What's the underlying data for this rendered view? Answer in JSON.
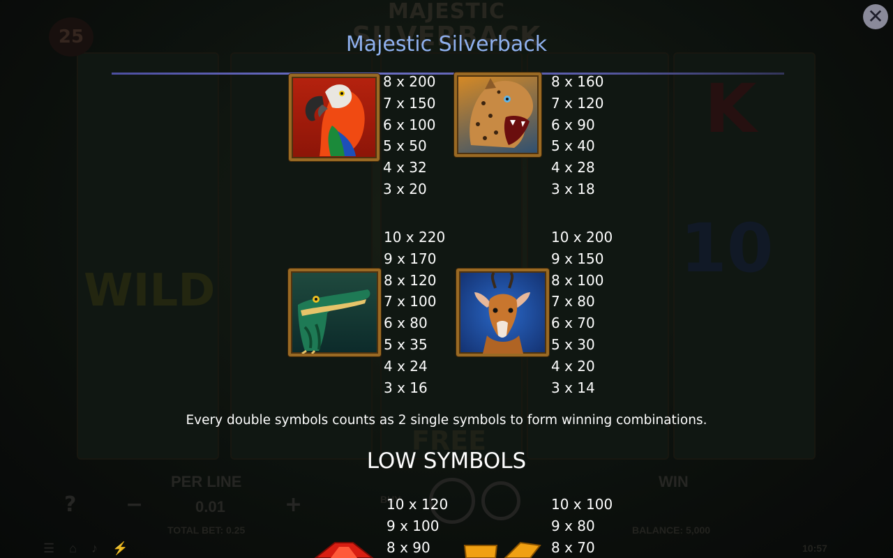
{
  "background": {
    "logo_line1": "MAJESTIC",
    "logo_line2": "SILVERBACK",
    "lines_count": "25",
    "wild_text": "WILD",
    "per_line_label": "PER LINE",
    "per_line_value": "0.01",
    "total_bet": "TOTAL BET: 0.25",
    "win_label": "WIN",
    "balance": "BALANCE: 5,000",
    "buy_label": "BUY",
    "free_text": "FREE",
    "minus": "−",
    "plus": "+",
    "help": "?",
    "clock": "10:57"
  },
  "paytable": {
    "title": "Majestic Silverback",
    "close_icon": "✕",
    "symbols": [
      {
        "name": "parrot",
        "payouts": [
          "8 x 200",
          "7 x 150",
          "6 x 100",
          "5 x 50",
          "4 x 32",
          "3 x 20"
        ]
      },
      {
        "name": "leopard",
        "payouts": [
          "8 x 160",
          "7 x 120",
          "6 x 90",
          "5 x 40",
          "4 x 28",
          "3 x 18"
        ]
      },
      {
        "name": "crocodile",
        "payouts": [
          "10 x 220",
          "9 x 170",
          "8 x 120",
          "7 x 100",
          "6 x 80",
          "5 x 35",
          "4 x 24",
          "3 x 16"
        ]
      },
      {
        "name": "antelope",
        "payouts": [
          "10 x 200",
          "9 x 150",
          "8 x 100",
          "7 x 80",
          "6 x 70",
          "5 x 30",
          "4 x 20",
          "3 x 14"
        ]
      },
      {
        "name": "ace",
        "payouts": [
          "10 x 120",
          "9 x 100",
          "8 x 90"
        ]
      },
      {
        "name": "king",
        "payouts": [
          "10 x 100",
          "9 x 80",
          "8 x 70"
        ]
      }
    ],
    "note": "Every double symbols counts as 2 single symbols to form winning combinations.",
    "low_symbols_heading": "LOW SYMBOLS"
  },
  "colors": {
    "title": "#8fb0ee",
    "rule": "#6d70c6",
    "frame": "#9a6a24",
    "text": "#ffffff"
  }
}
